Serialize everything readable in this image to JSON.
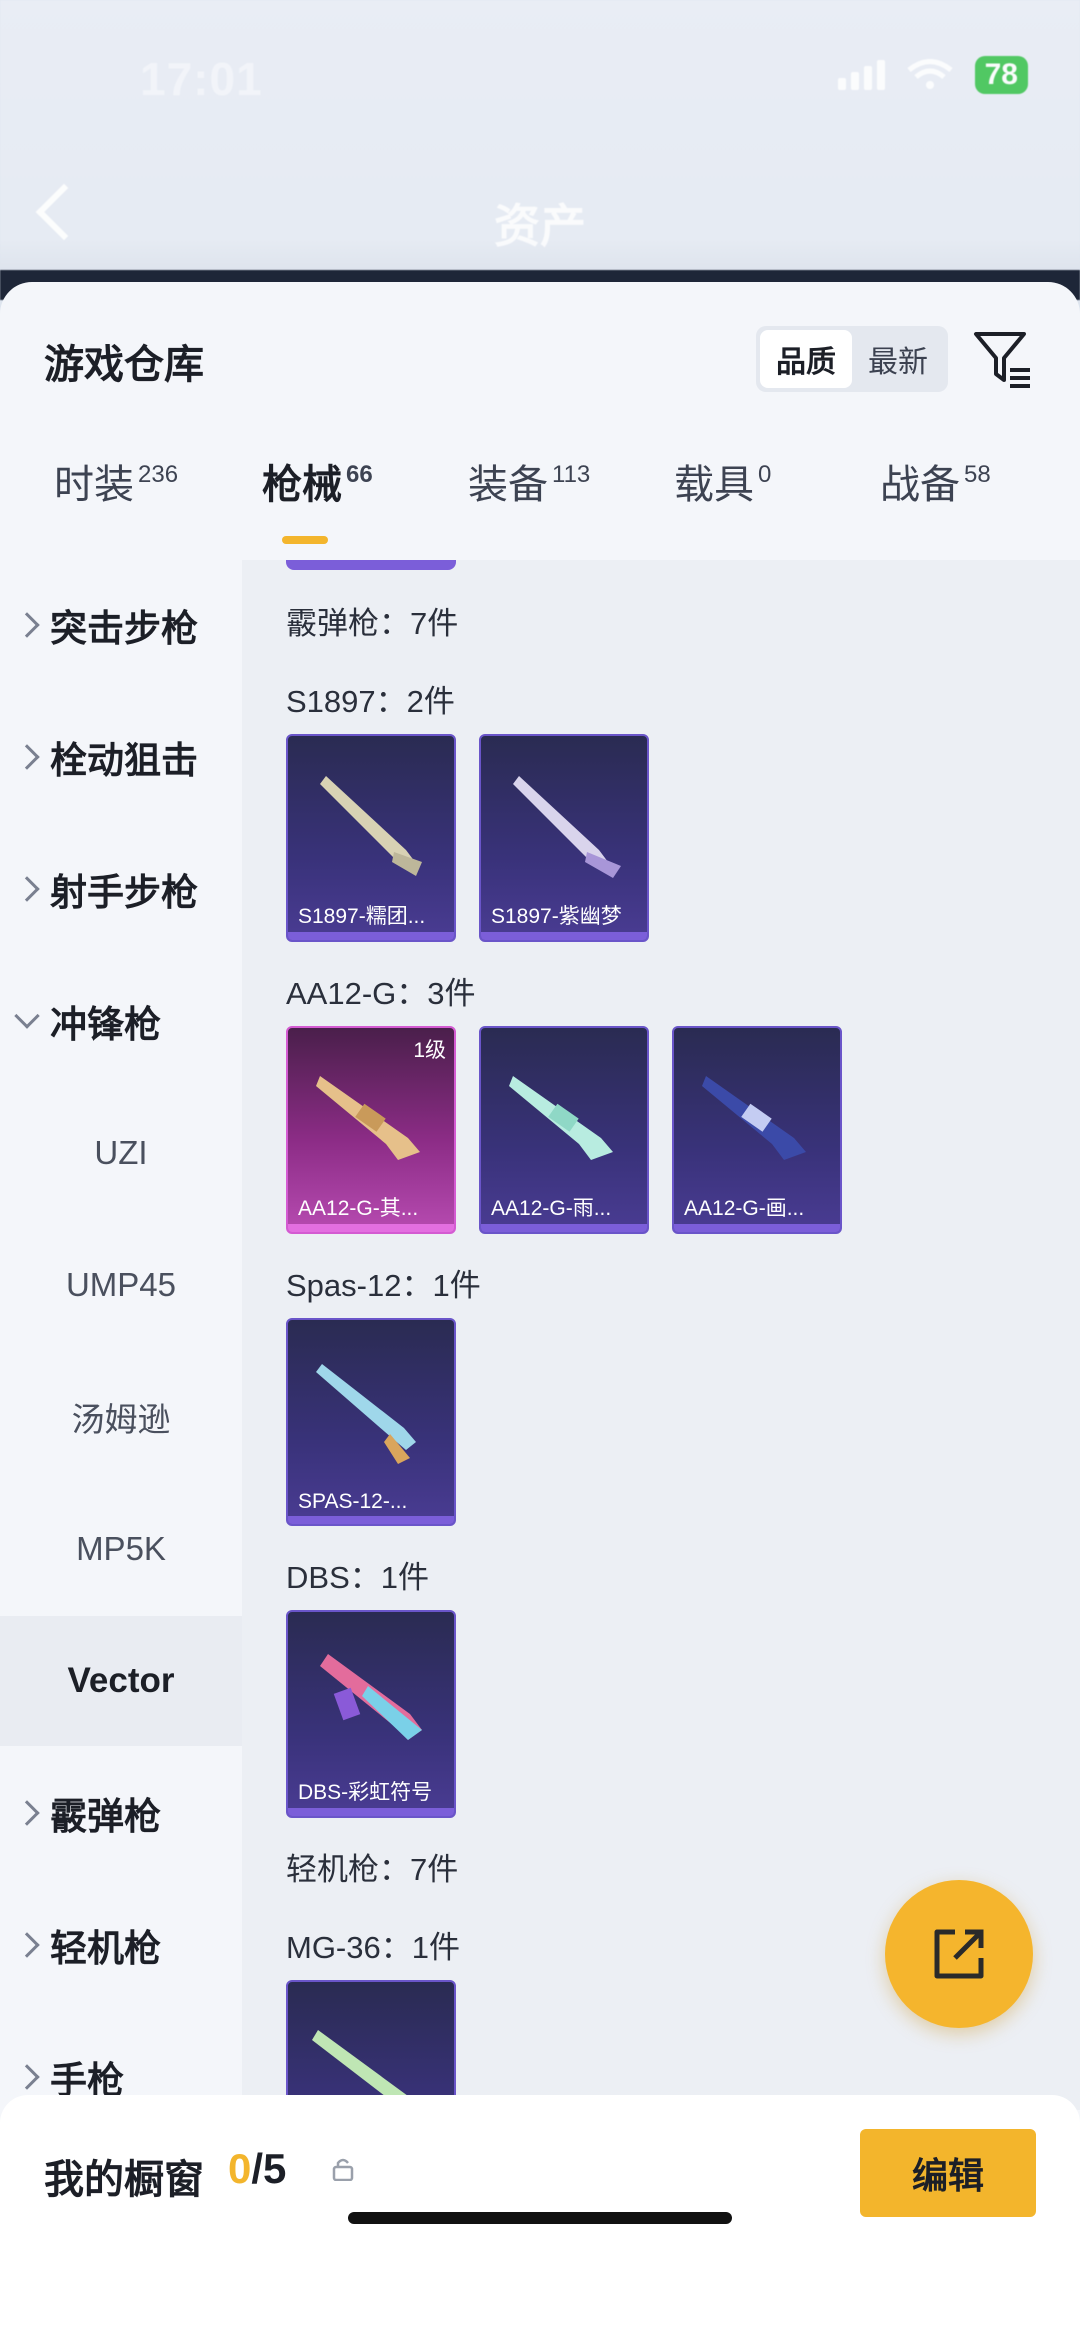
{
  "status_bar": {
    "time": "17:01",
    "battery": "78"
  },
  "background_header": {
    "title": "资产"
  },
  "sheet": {
    "title": "游戏仓库",
    "sort_options": [
      {
        "label": "品质",
        "active": true
      },
      {
        "label": "最新",
        "active": false
      }
    ]
  },
  "tabs": [
    {
      "label": "时装",
      "count": "236"
    },
    {
      "label": "枪械",
      "count": "66"
    },
    {
      "label": "装备",
      "count": "113"
    },
    {
      "label": "载具",
      "count": "0"
    },
    {
      "label": "战备",
      "count": "58"
    }
  ],
  "sidebar": {
    "categories": [
      {
        "label": "突击步枪"
      },
      {
        "label": "栓动狙击"
      },
      {
        "label": "射手步枪"
      },
      {
        "label": "冲锋枪"
      },
      {
        "label": "霰弹枪"
      },
      {
        "label": "轻机枪"
      },
      {
        "label": "手枪"
      }
    ],
    "subitems": [
      {
        "label": "UZI"
      },
      {
        "label": "UMP45"
      },
      {
        "label": "汤姆逊"
      },
      {
        "label": "MP5K"
      },
      {
        "label": "Vector"
      }
    ]
  },
  "content": {
    "sections": [
      {
        "label": "霰弹枪：7件"
      },
      {
        "label": "S1897：2件"
      },
      {
        "label": "AA12-G：3件"
      },
      {
        "label": "Spas-12：1件"
      },
      {
        "label": "DBS：1件"
      },
      {
        "label": "轻机枪：7件"
      },
      {
        "label": "MG-36：1件"
      }
    ],
    "cards": [
      {
        "caption": "S1897-糯团..."
      },
      {
        "caption": "S1897-紫幽梦"
      },
      {
        "caption": "AA12-G-其...",
        "level": "1级"
      },
      {
        "caption": "AA12-G-雨..."
      },
      {
        "caption": "AA12-G-画..."
      },
      {
        "caption": "SPAS-12-..."
      },
      {
        "caption": "DBS-彩虹符号"
      }
    ]
  },
  "bottom_bar": {
    "label": "我的橱窗",
    "current": "0",
    "total": "/5",
    "edit_label": "编辑"
  },
  "colors": {
    "accent": "#f3b52c",
    "purple_rarity": "#7b5ed9",
    "pink_rarity": "#d45bd2"
  }
}
